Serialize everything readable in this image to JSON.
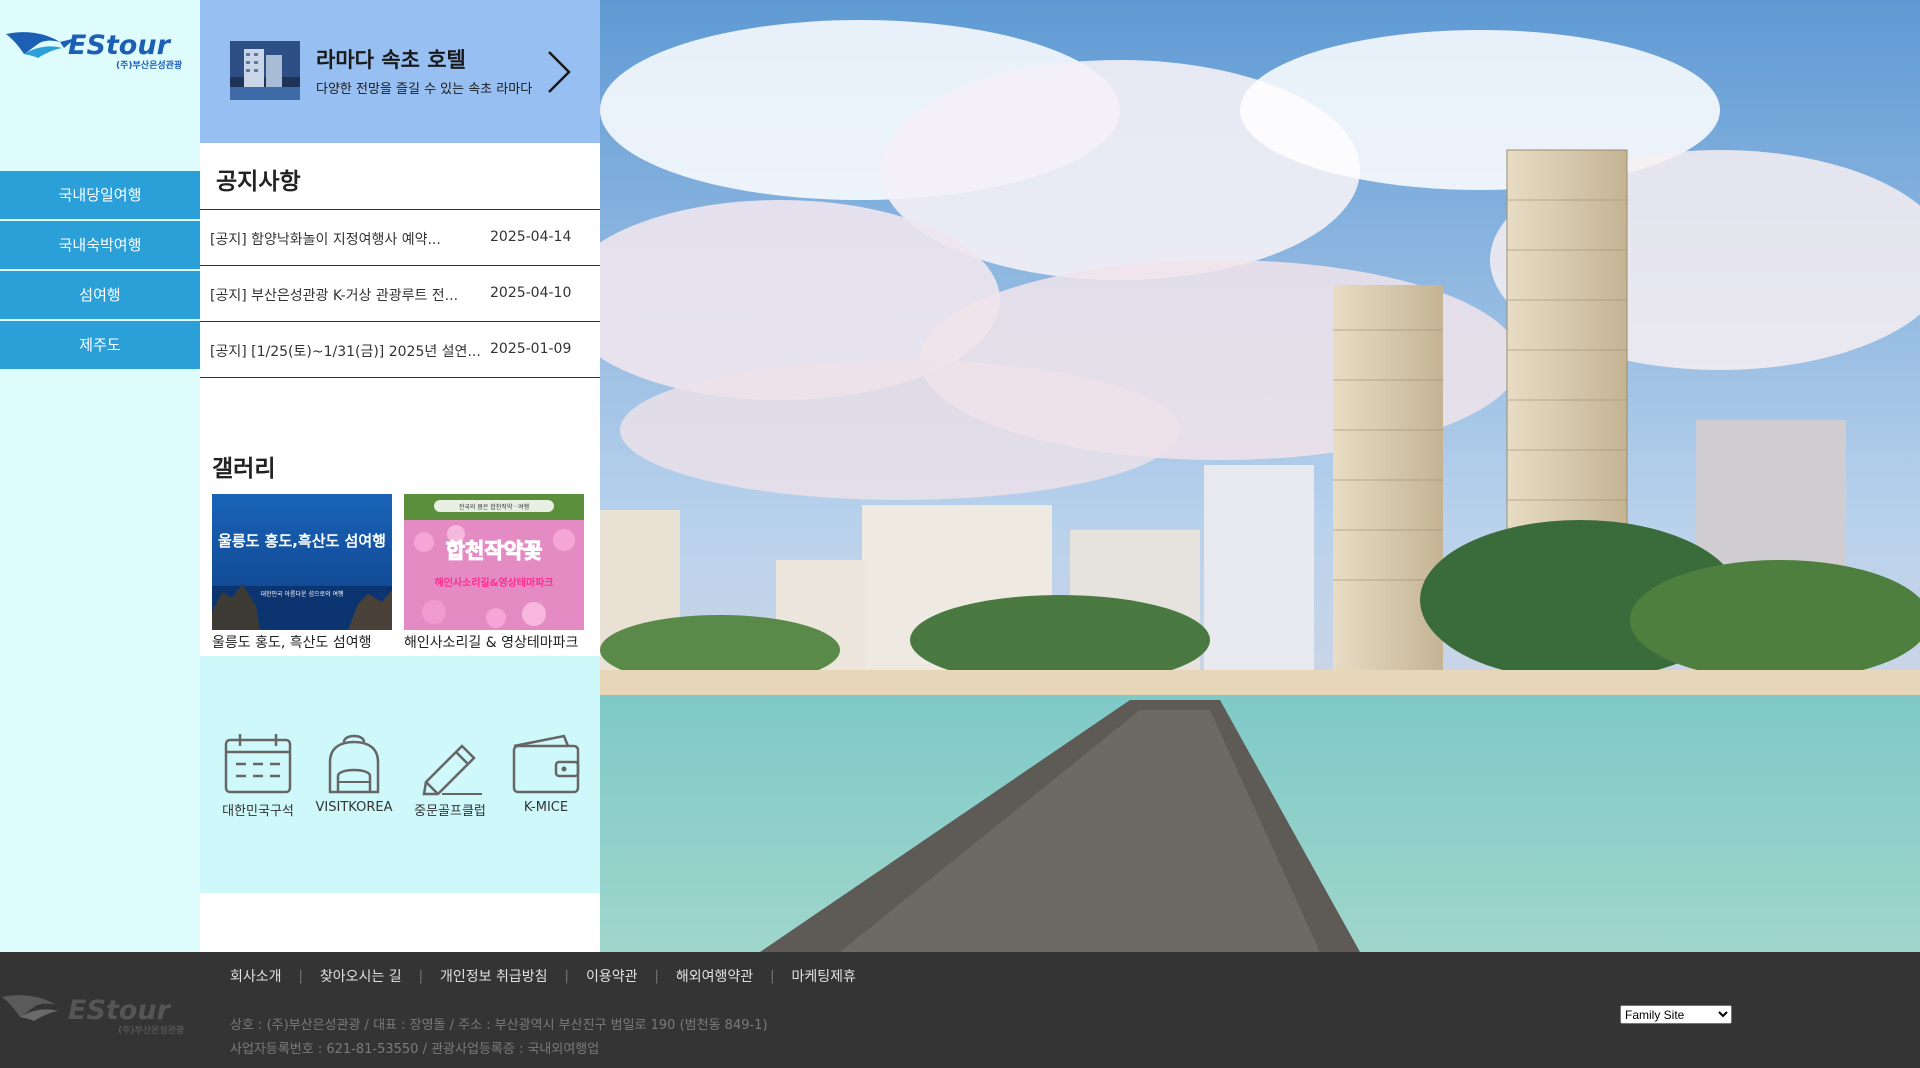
{
  "brand": {
    "logo_text": "EStour",
    "logo_sub": "(주)부산은성관광"
  },
  "sidebar": {
    "items": [
      {
        "label": "국내당일여행"
      },
      {
        "label": "국내숙박여행"
      },
      {
        "label": "섬여행"
      },
      {
        "label": "제주도"
      }
    ]
  },
  "hotel_banner": {
    "title": "라마다 속초 호텔",
    "description": "다양한 전망을 즐길 수 있는 속초 라마다"
  },
  "notice": {
    "title": "공지사항",
    "rows": [
      {
        "text": "[공지] 함양낙화놀이 지정여행사 예약...",
        "date": "2025-04-14"
      },
      {
        "text": "[공지] 부산은성관광 K-거상 관광루트 전...",
        "date": "2025-04-10"
      },
      {
        "text": "[공지] [1/25(토)~1/31(금)] 2025년 설연...",
        "date": "2025-01-09"
      }
    ]
  },
  "gallery": {
    "title": "갤러리",
    "items": [
      {
        "caption": "울릉도 홍도, 흑산도 섬여행",
        "image_text": "울릉도 홍도,흑산도 섬여행",
        "image_sub": "대한민국 아름다운 섬으로의 여행"
      },
      {
        "caption": "해인사소리길 & 영상테마파크",
        "image_text": "합천작약꽃",
        "image_sub": "해인사소리길&영상테마파크",
        "image_top": "전국의 봄은 합천작약 · 여행"
      }
    ]
  },
  "quick_links": [
    {
      "label": "대한민국구석",
      "icon": "calendar-icon"
    },
    {
      "label": "VISITKOREA",
      "icon": "backpack-icon"
    },
    {
      "label": "중문골프클럽",
      "icon": "pencil-icon"
    },
    {
      "label": "K-MICE",
      "icon": "wallet-icon"
    }
  ],
  "footer": {
    "links": [
      {
        "label": "회사소개"
      },
      {
        "label": "찾아오시는 길"
      },
      {
        "label": "개인정보 취급방침"
      },
      {
        "label": "이용약관"
      },
      {
        "label": "해외여행약관"
      },
      {
        "label": "마케팅제휴"
      }
    ],
    "info_line1": "상호 : (주)부산은성관광 / 대표 : 장영돌 / 주소 : 부산광역시 부산진구 범일로 190 (범천동 849-1)",
    "info_line2": "사업자등록번호 : 621-81-53550 / 관광사업등록증 : 국내외여행업",
    "family_site": "Family Site"
  },
  "colors": {
    "nav_blue": "#2a9fd8",
    "sidebar_bg": "#dffcfd",
    "banner_bg": "#98bff2",
    "links_bg": "#cff8fb",
    "footer_bg": "#343434",
    "logo_blue": "#1d5fb5"
  }
}
